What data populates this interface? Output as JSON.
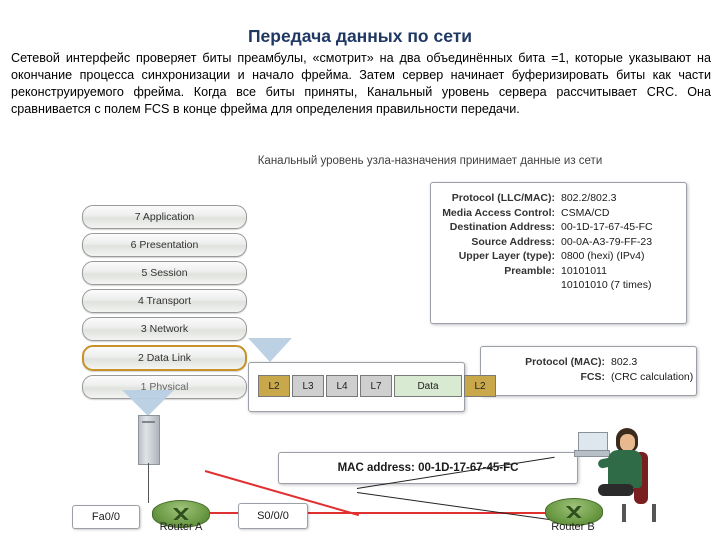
{
  "title": "Передача данных по сети",
  "body": "Сетевой интерфейс проверяет биты преамбулы, «смотрит» на два объединённых бита =1, которые указывают на окончание процесса синхронизации и начало фрейма. Затем сервер начинает буферизировать биты как части реконструируемого фрейма. Когда все биты приняты, Канальный уровень сервера рассчитывает CRC. Она сравнивается с полем FCS в конце фрейма для определения правильности передачи.",
  "caption": "Канальный уровень узла-назначения принимает данные из сети",
  "osi": {
    "layers": [
      {
        "label": "7 Application",
        "highlight": false
      },
      {
        "label": "6 Presentation",
        "highlight": false
      },
      {
        "label": "5 Session",
        "highlight": false
      },
      {
        "label": "4 Transport",
        "highlight": false
      },
      {
        "label": "3 Network",
        "highlight": false
      },
      {
        "label": "2 Data Link",
        "highlight": true
      },
      {
        "label": "1 Physical",
        "highlight": false
      }
    ]
  },
  "frame_panel": {
    "rows": [
      {
        "label": "Protocol (LLC/MAC):",
        "value": "802.2/802.3"
      },
      {
        "label": "Media Access Control:",
        "value": "CSMA/CD"
      },
      {
        "label": "Destination Address:",
        "value": "00-1D-17-67-45-FC"
      },
      {
        "label": "Source Address:",
        "value": "00-0A-A3-79-FF-23"
      },
      {
        "label": "Upper Layer (type):",
        "value": "0800 (hexi) (IPv4)"
      },
      {
        "label": "Preamble:",
        "value": "10101011"
      },
      {
        "label": "",
        "value": "10101010 (7 times)"
      }
    ]
  },
  "fcs_panel": {
    "rows": [
      {
        "label": "Protocol (MAC):",
        "value": "802.3"
      },
      {
        "label": "FCS:",
        "value": "(CRC calculation)"
      }
    ]
  },
  "frame_bar": {
    "segments": [
      {
        "label": "L2",
        "kind": "l2"
      },
      {
        "label": "L3",
        "kind": "l3"
      },
      {
        "label": "L4",
        "kind": "l4"
      },
      {
        "label": "L7",
        "kind": "l7"
      },
      {
        "label": "Data",
        "kind": "data"
      },
      {
        "label": "L2",
        "kind": "l2"
      }
    ]
  },
  "mac_panel": {
    "text": "MAC address: 00-1D-17-67-45-FC"
  },
  "network": {
    "router_a": "Router A",
    "router_b": "Router B",
    "fa00": "Fa0/0",
    "s000": "S0/0/0"
  },
  "colors": {
    "title": "#1f3864",
    "highlight_border": "#c8922a",
    "link_red": "#e03030",
    "data_segment": "#d9ead3",
    "l2_segment": "#c8a84b"
  }
}
